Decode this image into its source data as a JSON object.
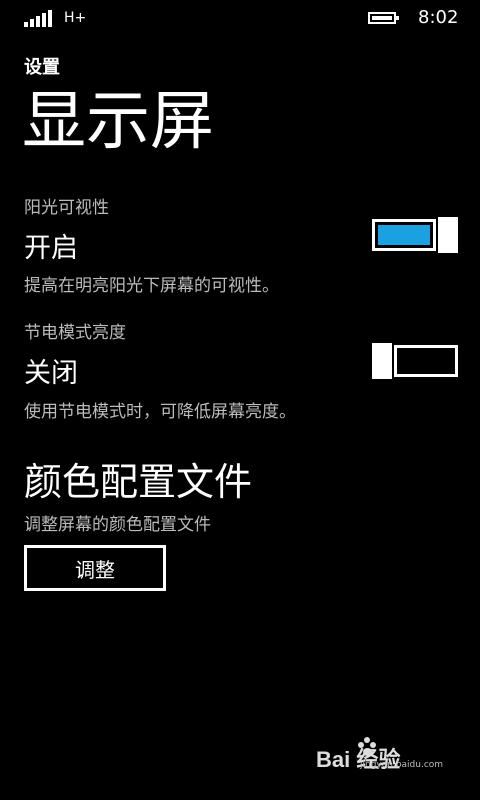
{
  "status_bar": {
    "network": "H+",
    "time": "8:02",
    "icons": [
      "signal-icon",
      "battery-icon"
    ]
  },
  "app_title": "设置",
  "page_title": "显示屏",
  "settings": [
    {
      "label": "阳光可视性",
      "value": "开启",
      "description": "提高在明亮阳光下屏幕的可视性。",
      "on": true
    },
    {
      "label": "节电模式亮度",
      "value": "关闭",
      "description": "使用节电模式时，可降低屏幕亮度。",
      "on": false
    }
  ],
  "color_profile": {
    "title": "颜色配置文件",
    "description": "调整屏幕的颜色配置文件",
    "button_label": "调整"
  },
  "watermark": {
    "logo": "Bai  经验",
    "sub": "jingyan.baidu.com"
  },
  "colors": {
    "background": "#000000",
    "accent": "#1ba1e2",
    "secondary_text": "#bbbbbb"
  }
}
